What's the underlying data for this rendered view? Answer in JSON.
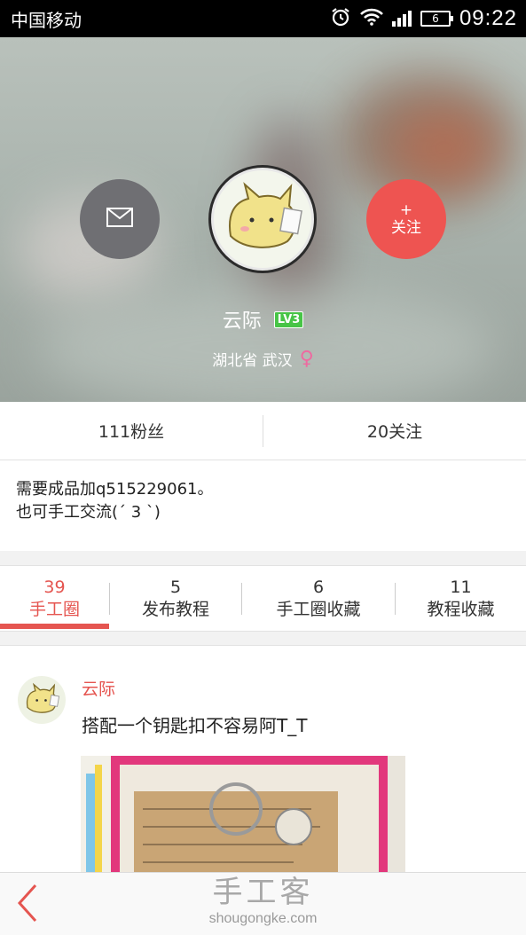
{
  "status_bar": {
    "carrier": "中国移动",
    "battery": "6",
    "time": "09:22"
  },
  "profile": {
    "username": "云际",
    "level": "LV3",
    "location": "湖北省 武汉",
    "gender_symbol": "♀",
    "follow_plus": "+",
    "follow_label": "关注"
  },
  "stats": {
    "fans": "111粉丝",
    "following": "20关注"
  },
  "bio": {
    "line1": "需要成品加q515229061。",
    "line2": "也可手工交流(ˊ 3 ˋ)"
  },
  "tabs": [
    {
      "count": "39",
      "label": "手工圈",
      "active": true
    },
    {
      "count": "5",
      "label": "发布教程",
      "active": false
    },
    {
      "count": "6",
      "label": "手工圈收藏",
      "active": false
    },
    {
      "count": "11",
      "label": "教程收藏",
      "active": false
    }
  ],
  "post": {
    "author": "云际",
    "text": "搭配一个钥匙扣不容易阿T_T"
  },
  "bottom_bar": {
    "watermark_title": "手工客",
    "watermark_url": "shougongke.com"
  },
  "colors": {
    "accent": "#e55550",
    "follow_button": "#ee5451",
    "message_button": "#6f6f73",
    "level_badge": "#47c446",
    "gender": "#ee6aa0"
  },
  "icons": [
    "alarm-icon",
    "wifi-icon",
    "signal-icon",
    "battery-icon",
    "envelope-icon",
    "back-arrow-icon"
  ]
}
